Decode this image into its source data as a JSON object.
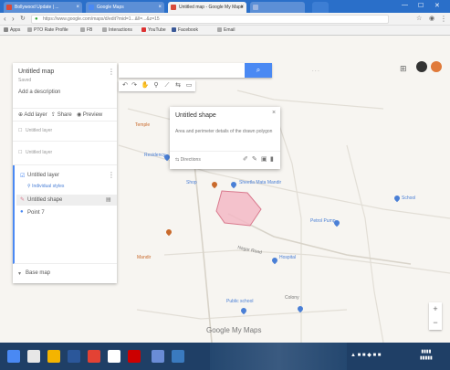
{
  "browser": {
    "tabs": [
      {
        "label": "Bollywood Update | ...",
        "active": false,
        "fav_color": "#d84a3a"
      },
      {
        "label": "Google Maps",
        "active": false,
        "fav_color": "#4a89f3"
      },
      {
        "label": "Untitled map - Google My Maps",
        "active": true,
        "fav_color": "#d84a3a"
      },
      {
        "label": "",
        "active": false,
        "fav_color": "#9cb5e0"
      }
    ],
    "url": "https://www.google.com/maps/d/edit?mid=1...&ll=...&z=15",
    "bookmarks": [
      "Apps",
      "PTO Rate Profile",
      "FB",
      "Interactions",
      "YouTube",
      "Facebook",
      "Email"
    ]
  },
  "panel": {
    "title": "Untitled map",
    "subtitle": "Saved",
    "description": "Add a description",
    "actions": [
      "Add layer",
      "Share",
      "Preview"
    ],
    "layers": [
      {
        "name": "Untitled layer",
        "items": []
      },
      {
        "name": "Untitled layer",
        "items": []
      },
      {
        "name": "Untitled layer",
        "items": [
          "Individual styles",
          "Untitled shape",
          "Point 7"
        ]
      }
    ],
    "basemap": "Base map"
  },
  "popup": {
    "title": "Untitled shape",
    "text": "Area and perimeter details of the drawn polygon",
    "footer": "Directions"
  },
  "map_labels": [
    {
      "text": "Temple",
      "color": "#c96a2c"
    },
    {
      "text": "Residency",
      "color": "#4a7fd6"
    },
    {
      "text": "Sheetla Mata Mandir",
      "color": "#4a7fd6"
    },
    {
      "text": "Nagar Road",
      "color": "#777"
    },
    {
      "text": "Shop",
      "color": "#4a7fd6"
    },
    {
      "text": "Petrol Pump",
      "color": "#4a7fd6"
    },
    {
      "text": "Hospital",
      "color": "#4a7fd6"
    },
    {
      "text": "School",
      "color": "#4a7fd6"
    },
    {
      "text": "Mandir",
      "color": "#c96a2c"
    },
    {
      "text": "Public school",
      "color": "#4a7fd6"
    },
    {
      "text": "Colony",
      "color": "#777"
    }
  ],
  "map": {
    "watermark": "Google My Maps"
  },
  "colors": {
    "accent": "#4a89f3",
    "polygon_fill": "#f3b8c5",
    "polygon_stroke": "#d97a8e",
    "taskbar": "#1f3f66"
  }
}
